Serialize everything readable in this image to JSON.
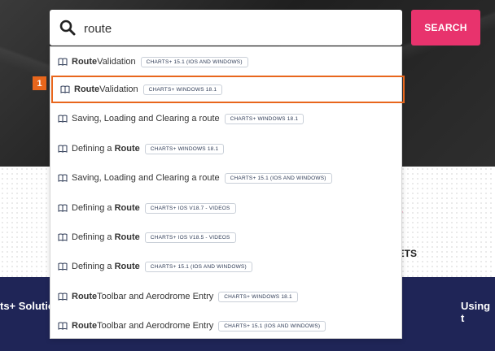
{
  "search": {
    "value": "route",
    "button_label": "SEARCH"
  },
  "marker": {
    "label": "1"
  },
  "results": [
    {
      "bold": "Route",
      "rest": " Validation",
      "tag": "CHARTS+ 15.1 (IOS AND WINDOWS)"
    },
    {
      "bold": "Route",
      "rest": " Validation",
      "tag": "CHARTS+ WINDOWS 18.1"
    },
    {
      "bold": "Saving, Loading and Clearing a route",
      "rest": "",
      "tag": "CHARTS+ WINDOWS 18.1"
    },
    {
      "pre": "Defining a ",
      "bold": "Route",
      "rest": "",
      "tag": "CHARTS+ WINDOWS 18.1"
    },
    {
      "bold": "Saving, Loading and Clearing a route",
      "rest": "",
      "tag": "CHARTS+ 15.1 (IOS AND WINDOWS)"
    },
    {
      "pre": "Defining a ",
      "bold": "Route",
      "rest": "",
      "tag": "CHARTS+ IOS V18.7 - VIDEOS"
    },
    {
      "pre": "Defining a ",
      "bold": "Route",
      "rest": "",
      "tag": "CHARTS+ IOS V18.5 - VIDEOS"
    },
    {
      "pre": "Defining a ",
      "bold": "Route",
      "rest": "",
      "tag": "CHARTS+ 15.1 (IOS AND WINDOWS)"
    },
    {
      "bold": "Route",
      "rest": " Toolbar and Aerodrome Entry",
      "tag": "CHARTS+ WINDOWS 18.1"
    },
    {
      "bold": "Route",
      "rest": " Toolbar and Aerodrome Entry",
      "tag": "CHARTS+ 15.1 (IOS AND WINDOWS)"
    }
  ],
  "background": {
    "mid_heading": "ETS",
    "navy_left": "ts+ Solutio",
    "navy_right": "Using t"
  },
  "colors": {
    "accent": "#e8336d",
    "selection": "#e8661c",
    "navy": "#1f2557"
  }
}
